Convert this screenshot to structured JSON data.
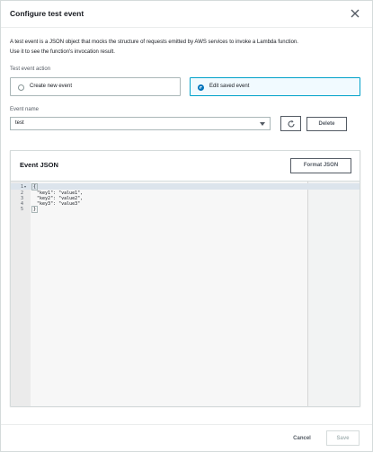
{
  "modal": {
    "title": "Configure test event",
    "description_line1": "A test event is a JSON object that mocks the structure of requests emitted by AWS services to invoke a Lambda function.",
    "description_line2": "Use it to see the function's invocation result."
  },
  "test_event_action": {
    "label": "Test event action",
    "options": [
      {
        "label": "Create new event",
        "selected": false
      },
      {
        "label": "Edit saved event",
        "selected": true
      }
    ]
  },
  "event_name": {
    "label": "Event name",
    "value": "test"
  },
  "buttons": {
    "delete": "Delete",
    "format_json": "Format JSON",
    "cancel": "Cancel",
    "save": "Save"
  },
  "event_json": {
    "title": "Event JSON",
    "line_numbers": [
      "1",
      "2",
      "3",
      "4",
      "5"
    ],
    "lines": [
      "{",
      "  \"key1\": \"value1\",",
      "  \"key2\": \"value2\",",
      "  \"key3\": \"value3\"",
      "}"
    ]
  },
  "colors": {
    "accent": "#0073bb",
    "selected_border": "#00a1c9",
    "selected_bg": "#f1faff"
  },
  "icons": {
    "close": "close-icon",
    "refresh": "refresh-icon",
    "dropdown": "caret-down-icon"
  }
}
